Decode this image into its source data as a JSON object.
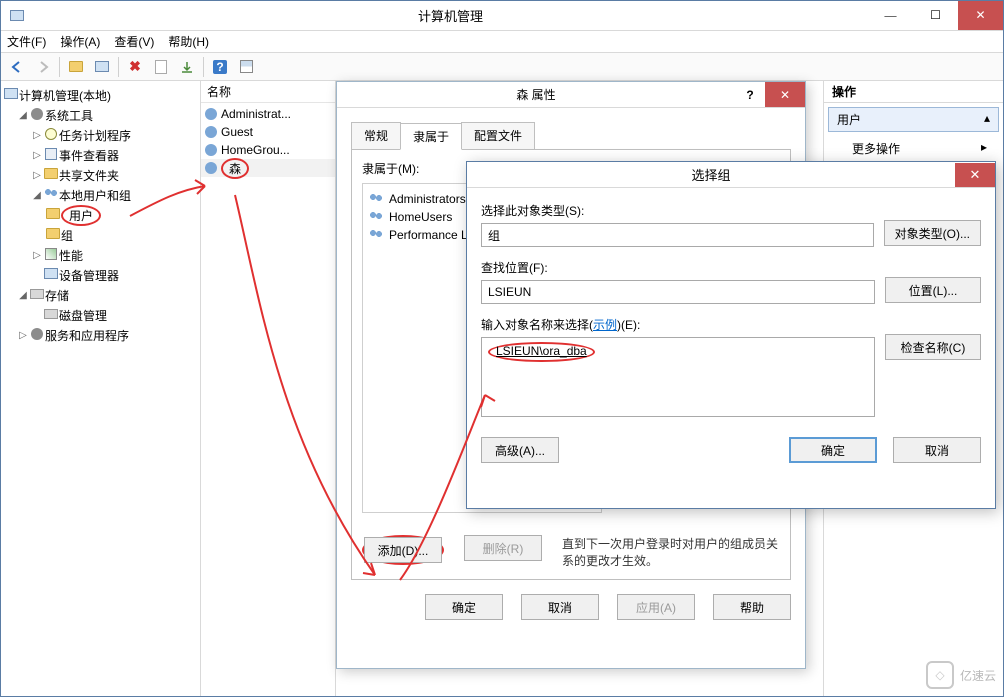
{
  "window": {
    "title": "计算机管理"
  },
  "menu": {
    "file": "文件(F)",
    "action": "操作(A)",
    "view": "查看(V)",
    "help": "帮助(H)"
  },
  "toolbar_icons": [
    "back",
    "fwd",
    "up",
    "props",
    "delete",
    "refresh",
    "export",
    "help",
    "tile"
  ],
  "tree": {
    "root": "计算机管理(本地)",
    "sys_tools": "系统工具",
    "task_sched": "任务计划程序",
    "event_viewer": "事件查看器",
    "shared_folders": "共享文件夹",
    "local_users_groups": "本地用户和组",
    "users": "用户",
    "groups": "组",
    "performance": "性能",
    "dev_mgr": "设备管理器",
    "storage": "存储",
    "disk_mgmt": "磁盘管理",
    "services_apps": "服务和应用程序"
  },
  "listhead": {
    "name": "名称"
  },
  "userlist": {
    "admin": "Administrat...",
    "guest": "Guest",
    "homegroup": "HomeGrou...",
    "sen": "森"
  },
  "actions": {
    "pane_title": "操作",
    "users_header": "用户",
    "more_ops": "更多操作"
  },
  "props": {
    "title": "森 属性",
    "help": "?",
    "tab_general": "常规",
    "tab_memberof": "隶属于",
    "tab_profile": "配置文件",
    "memberof_label": "隶属于(M):",
    "groups": {
      "admins": "Administrators",
      "homeusers": "HomeUsers",
      "perflog": "Performance Log"
    },
    "add": "添加(D)...",
    "remove": "删除(R)",
    "note": "直到下一次用户登录时对用户的组成员关系的更改才生效。",
    "ok": "确定",
    "cancel": "取消",
    "apply": "应用(A)",
    "help_btn": "帮助"
  },
  "selgrp": {
    "title": "选择组",
    "obj_type_label": "选择此对象类型(S):",
    "obj_type_value": "组",
    "obj_type_btn": "对象类型(O)...",
    "location_label": "查找位置(F):",
    "location_value": "LSIEUN",
    "location_btn": "位置(L)...",
    "name_label_pre": "输入对象名称来选择(",
    "name_label_link": "示例",
    "name_label_post": ")(E):",
    "name_value": "LSIEUN\\ora_dba",
    "check_names": "检查名称(C)",
    "advanced": "高级(A)...",
    "ok": "确定",
    "cancel": "取消"
  },
  "watermark": "亿速云"
}
